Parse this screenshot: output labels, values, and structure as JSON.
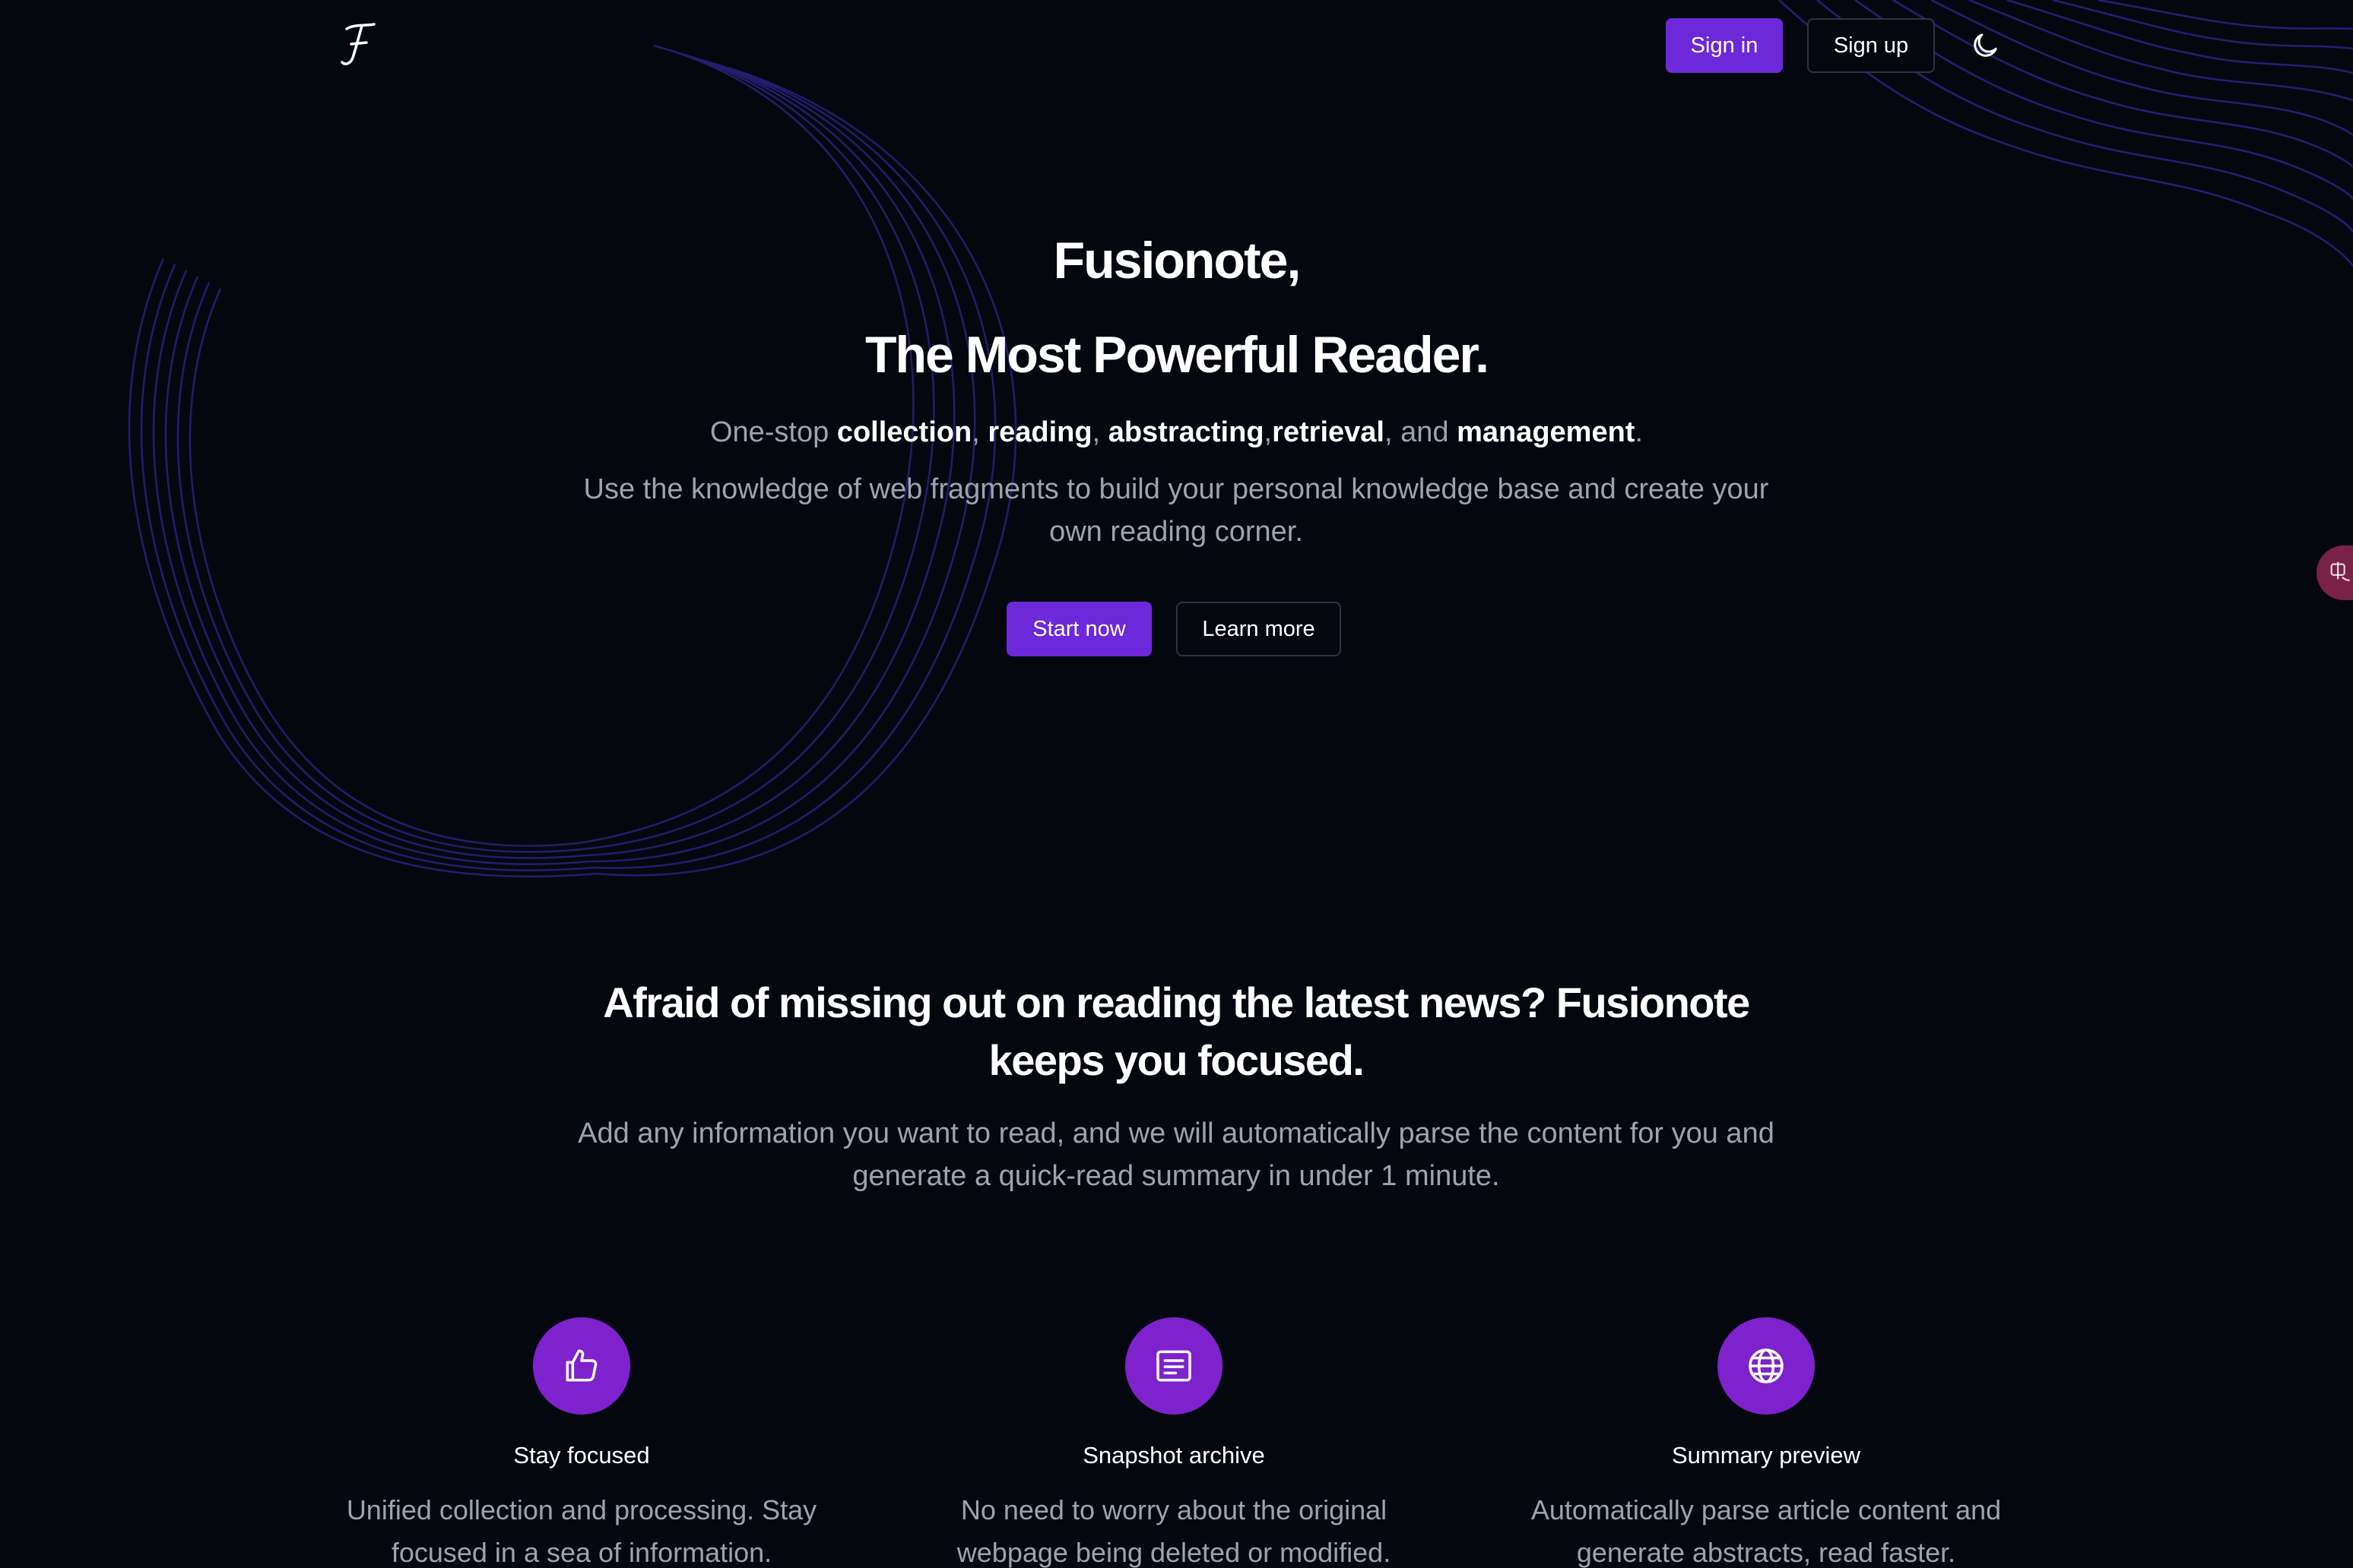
{
  "header": {
    "logo_glyph": "𝓕",
    "signin_label": "Sign in",
    "signup_label": "Sign up",
    "theme_icon": "moon-icon"
  },
  "side_widget": {
    "icon": "translate-icon"
  },
  "hero": {
    "title_line1": "Fusionote,",
    "title_line2": "The Most Powerful Reader.",
    "tagline": {
      "prefix": "One-stop ",
      "collection": "collection",
      "sep1": ", ",
      "reading": "reading",
      "sep2": ", ",
      "abstracting": "abstracting",
      "sep3": ",",
      "retrieval": "retrieval",
      "sep4": ", and ",
      "management": "management",
      "suffix": "."
    },
    "description": "Use the knowledge of web fragments to build your personal knowledge base and create your own reading corner.",
    "start_label": "Start now",
    "learn_label": "Learn more"
  },
  "section": {
    "title": "Afraid of missing out on reading the latest news? Fusionote keeps you focused.",
    "description": "Add any information you want to read, and we will automatically parse the content for you and generate a quick-read summary in under 1 minute."
  },
  "features": [
    {
      "icon": "thumbs-up-icon",
      "title": "Stay focused",
      "description": "Unified collection and processing. Stay focused in a sea of information."
    },
    {
      "icon": "document-icon",
      "title": "Snapshot archive",
      "description": "No need to worry about the original webpage being deleted or modified."
    },
    {
      "icon": "globe-icon",
      "title": "Summary preview",
      "description": "Automatically parse article content and generate abstracts, read faster."
    }
  ],
  "colors": {
    "background": "#05070f",
    "accent": "#6d28d9",
    "feature_circle": "#7e22ce",
    "muted_text": "#9ca3af",
    "wave": "#3b30b8"
  }
}
